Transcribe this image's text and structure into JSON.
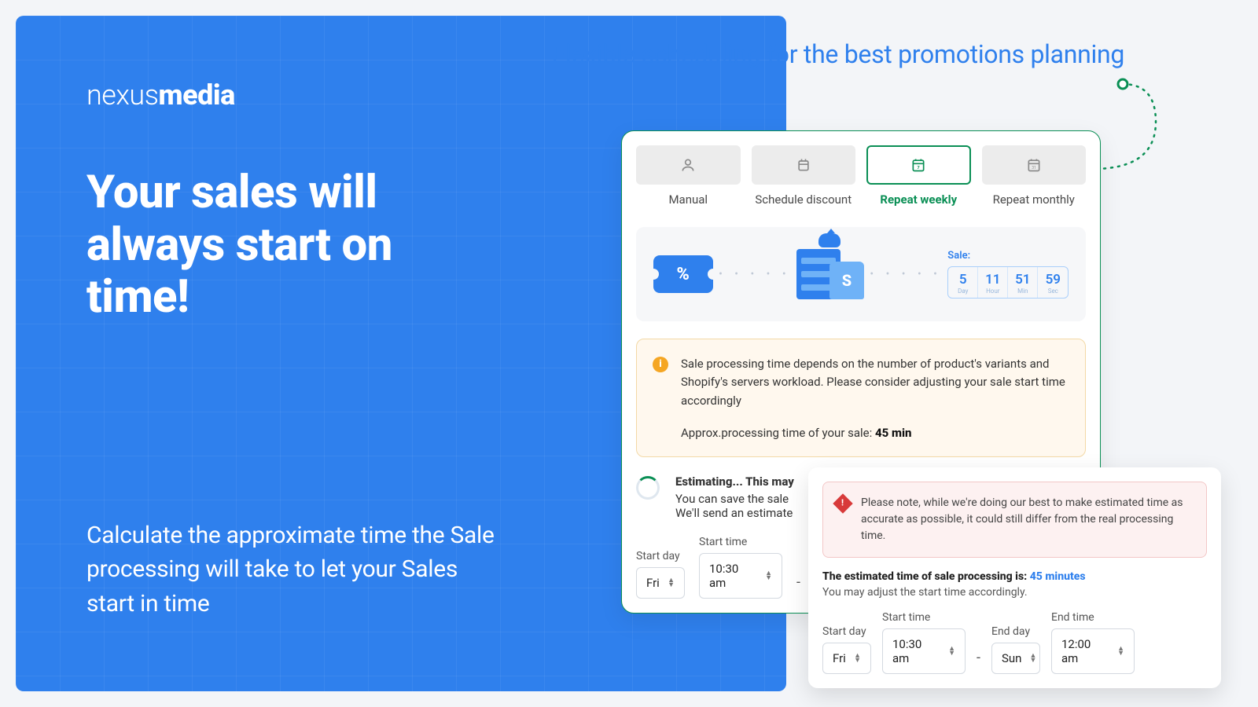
{
  "brand": {
    "logo_prefix": "nexus",
    "logo_bold": "media"
  },
  "hero": {
    "headline": "Your sales will always start on time!",
    "subcopy": "Calculate the approximate time the Sale processing will take to let your Sales start in time"
  },
  "callout": "Flexible scheduling for the best promotions planning",
  "tabs": {
    "manual": "Manual",
    "schedule": "Schedule discount",
    "weekly": "Repeat weekly",
    "monthly": "Repeat monthly",
    "active": "weekly"
  },
  "timer": {
    "label": "Sale:",
    "segments": [
      {
        "v": "5",
        "u": "Day"
      },
      {
        "v": "11",
        "u": "Hour"
      },
      {
        "v": "51",
        "u": "Min"
      },
      {
        "v": "59",
        "u": "Sec"
      }
    ]
  },
  "notice_warn": {
    "body": "Sale processing time depends on the number of product's variants and Shopify's servers workload. Please consider adjusting your sale start time accordingly",
    "approx_label": "Approx.processing time of your sale:",
    "approx_value": "45 min"
  },
  "estimating": {
    "title": "Estimating... This may",
    "line1": "You can save the sale",
    "line2": "We'll send an estimate"
  },
  "fields1": {
    "start_day_label": "Start day",
    "start_time_label": "Start time",
    "start_day": "Fri",
    "start_time": "10:30 am"
  },
  "notice_pink": {
    "body": "Please note, while we're doing our best to make estimated time as accurate as possible, it could still differ from the real processing time."
  },
  "est_result": {
    "key": "The estimated time of sale processing is:",
    "value": "45 minutes",
    "adjust": "You may adjust the start time accordingly."
  },
  "fields2": {
    "start_day_label": "Start day",
    "start_time_label": "Start time",
    "end_day_label": "End day",
    "end_time_label": "End time",
    "start_day": "Fri",
    "start_time": "10:30 am",
    "end_day": "Sun",
    "end_time": "12:00 am"
  }
}
